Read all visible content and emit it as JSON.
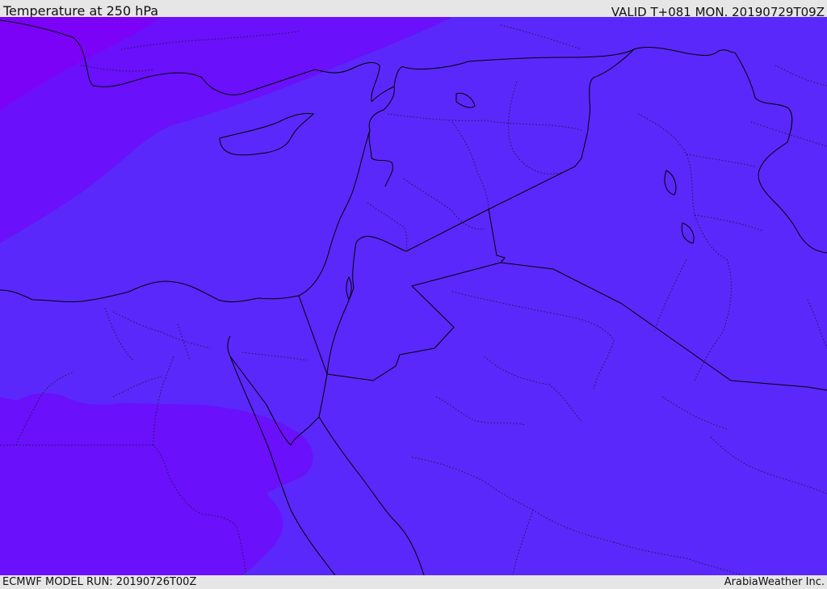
{
  "header": {
    "title": "Temperature at 250 hPa",
    "valid_time": "VALID T+081 MON. 20190729T09Z"
  },
  "footer": {
    "model_run": "ECMWF MODEL RUN: 20190726T00Z",
    "credit": "ArabiaWeather Inc."
  },
  "map": {
    "field": "Temperature at 250 hPa",
    "colors": {
      "main_band": "#5a28fa",
      "cool_band": "#6a10fb",
      "coldest_band": "#7b02f7",
      "border_line": "#000000",
      "admin_line": "#1a1a4a"
    }
  }
}
